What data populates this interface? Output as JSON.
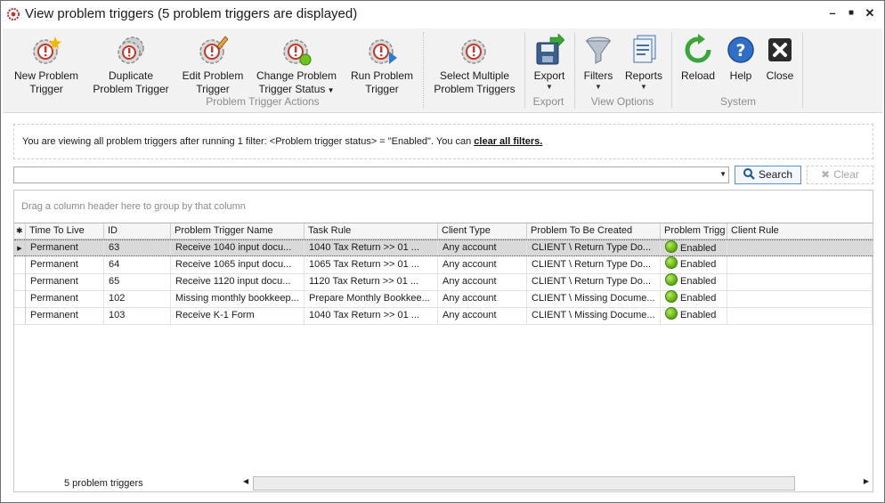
{
  "window": {
    "title": "View problem triggers (5 problem triggers are displayed)"
  },
  "ribbon": {
    "groups": [
      {
        "label": "Problem Trigger Actions"
      },
      {
        "label": "Export"
      },
      {
        "label": "View Options"
      },
      {
        "label": "System"
      }
    ],
    "buttons": {
      "new_line1": "New Problem",
      "new_line2": "Trigger",
      "dup_line1": "Duplicate",
      "dup_line2": "Problem Trigger",
      "edit_line1": "Edit Problem",
      "edit_line2": "Trigger",
      "change_line1": "Change Problem",
      "change_line2": "Trigger Status",
      "run_line1": "Run Problem",
      "run_line2": "Trigger",
      "select_line1": "Select Multiple",
      "select_line2": "Problem Triggers",
      "export": "Export",
      "filters": "Filters",
      "reports": "Reports",
      "reload": "Reload",
      "help": "Help",
      "close": "Close"
    }
  },
  "filter_bar": {
    "text": "You are viewing all problem triggers after running 1 filter: <Problem trigger status> = \"Enabled\". You can ",
    "link": "clear all filters."
  },
  "search": {
    "value": "",
    "search_label": "Search",
    "clear_label": "Clear"
  },
  "grid": {
    "group_hint": "Drag a column header here to group by that column",
    "columns": [
      "Time To Live",
      "ID",
      "Problem Trigger Name",
      "Task Rule",
      "Client Type",
      "Problem To Be Created",
      "Problem Trigg",
      "Client Rule"
    ],
    "rows": [
      {
        "ttl": "Permanent",
        "id": "63",
        "name": "Receive 1040 input docu...",
        "task": "1040 Tax Return >> 01 ...",
        "client_type": "Any account",
        "problem": "CLIENT \\ Return Type Do...",
        "status": "Enabled",
        "client_rule": ""
      },
      {
        "ttl": "Permanent",
        "id": "64",
        "name": "Receive 1065 input docu...",
        "task": "1065 Tax Return >> 01 ...",
        "client_type": "Any account",
        "problem": "CLIENT \\ Return Type Do...",
        "status": "Enabled",
        "client_rule": ""
      },
      {
        "ttl": "Permanent",
        "id": "65",
        "name": "Receive 1120 input docu...",
        "task": "1120 Tax Return >> 01 ...",
        "client_type": "Any account",
        "problem": "CLIENT \\ Return Type Do...",
        "status": "Enabled",
        "client_rule": ""
      },
      {
        "ttl": "Permanent",
        "id": "102",
        "name": "Missing monthly bookkeep...",
        "task": "Prepare Monthly Bookkee...",
        "client_type": "Any account",
        "problem": "CLIENT \\ Missing Docume...",
        "status": "Enabled",
        "client_rule": ""
      },
      {
        "ttl": "Permanent",
        "id": "103",
        "name": "Receive K-1 Form",
        "task": "1040 Tax Return >> 01 ...",
        "client_type": "Any account",
        "problem": "CLIENT \\ Missing Docume...",
        "status": "Enabled",
        "client_rule": ""
      }
    ],
    "footer_count": "5 problem triggers"
  },
  "colors": {
    "accent": "#5a8fd0",
    "enabled": "#5aa80f"
  }
}
